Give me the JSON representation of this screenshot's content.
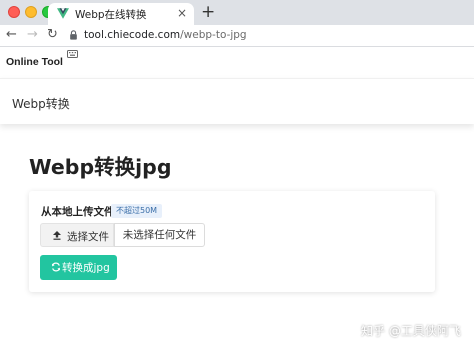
{
  "browser": {
    "tab_title": "Webp在线转换",
    "tab_close": "×",
    "new_tab": "+",
    "url_host": "tool.chiecode.com",
    "url_path": "/webp-to-jpg",
    "colors": {
      "favicon_outer": "#41b883",
      "favicon_inner": "#35495e"
    }
  },
  "header": {
    "brand": "Online Tool"
  },
  "nav": {
    "items": [
      {
        "label": "Webp转换"
      }
    ]
  },
  "main": {
    "title": "Webp转换jpg",
    "upload": {
      "label": "从本地上传文件",
      "badge": "不超过50M",
      "choose_button": "选择文件",
      "file_status": "未选择任何文件"
    },
    "convert_button": "转换成jpg",
    "accent_color": "#22c5a0"
  },
  "watermark": "知乎 @工具侠阿飞"
}
